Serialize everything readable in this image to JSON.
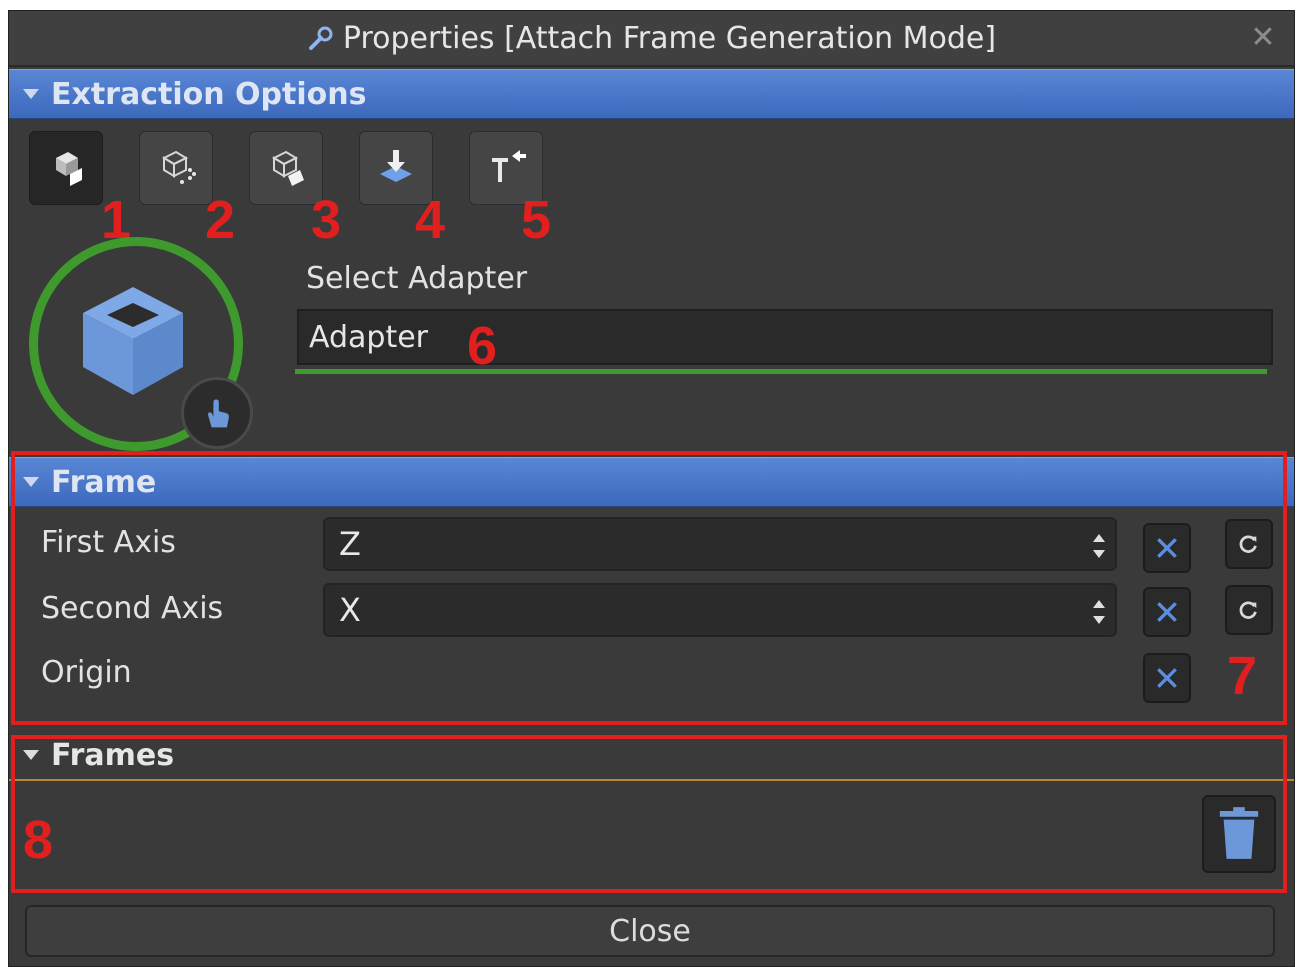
{
  "window": {
    "title": "Properties [Attach Frame Generation Mode]",
    "close_glyph": "✕"
  },
  "extraction": {
    "header": "Extraction Options",
    "tools": [
      {
        "icon": "cube-face-icon",
        "marker": "1",
        "active": true
      },
      {
        "icon": "cube-points-icon",
        "marker": "2",
        "active": false
      },
      {
        "icon": "cube-edge-icon",
        "marker": "3",
        "active": false
      },
      {
        "icon": "project-down-icon",
        "marker": "4",
        "active": false
      },
      {
        "icon": "axis-arrow-icon",
        "marker": "5",
        "active": false
      }
    ],
    "select_label": "Select Adapter",
    "adapter_value": "Adapter",
    "adapter_marker": "6"
  },
  "frame": {
    "header": "Frame",
    "first_axis_label": "First Axis",
    "first_axis_value": "Z",
    "second_axis_label": "Second Axis",
    "second_axis_value": "X",
    "origin_label": "Origin",
    "marker": "7"
  },
  "frames": {
    "header": "Frames",
    "marker": "8"
  },
  "footer": {
    "close_label": "Close"
  },
  "colors": {
    "accent_blue": "#4a78cc",
    "ring_green": "#3f9a2d",
    "marker_red": "#e21f1f",
    "divider_orange": "#b8892a"
  }
}
